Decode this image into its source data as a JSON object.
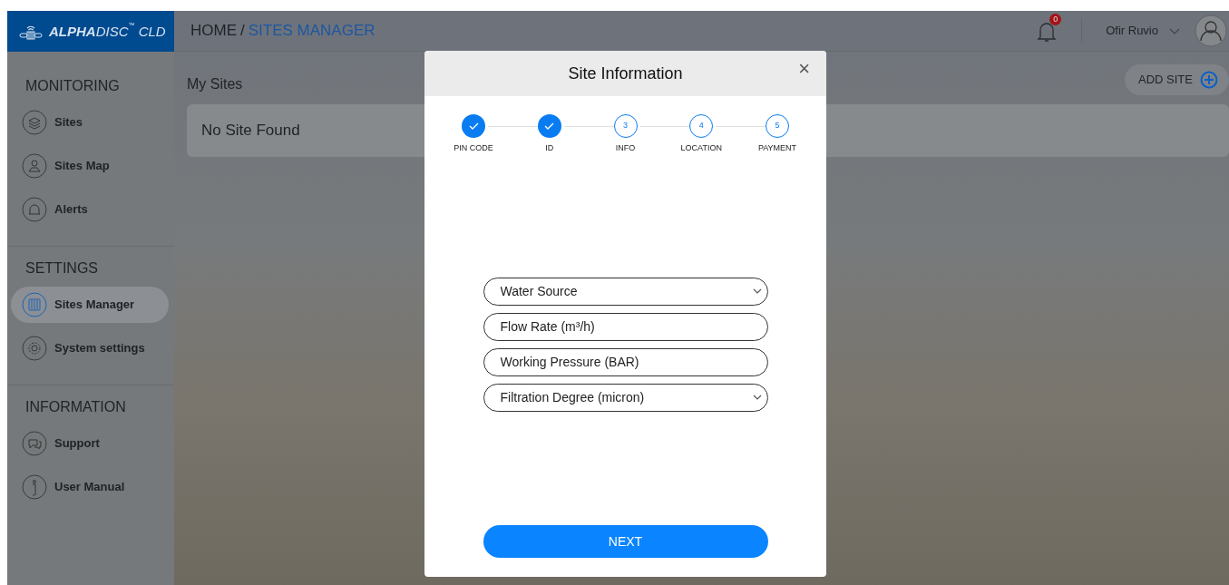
{
  "logo": {
    "brand_bold": "ALPHA",
    "brand_rest": "DISC",
    "trademark": "™",
    "suffix": "CLD"
  },
  "breadcrumb": {
    "items": [
      {
        "label": "HOME",
        "current": false
      },
      {
        "label": "SITES MANAGER",
        "current": true
      }
    ],
    "separator": "/"
  },
  "header": {
    "notification_count": "0",
    "user_name": "Ofir Ruvio"
  },
  "sidebar": {
    "sections": [
      {
        "title": "MONITORING",
        "items": [
          {
            "label": "Sites",
            "selected": false
          },
          {
            "label": "Sites Map",
            "selected": false
          },
          {
            "label": "Alerts",
            "selected": false
          }
        ]
      },
      {
        "title": "SETTINGS",
        "items": [
          {
            "label": "Sites Manager",
            "selected": true
          },
          {
            "label": "System settings",
            "selected": false
          }
        ]
      },
      {
        "title": "INFORMATION",
        "items": [
          {
            "label": "Support",
            "selected": false
          },
          {
            "label": "User Manual",
            "selected": false
          }
        ]
      }
    ]
  },
  "content": {
    "title": "My Sites",
    "add_button": "ADD SITE",
    "empty_message": "No Site Found"
  },
  "modal": {
    "title": "Site Information",
    "close": "×",
    "steps": [
      {
        "label": "PIN CODE",
        "done": true
      },
      {
        "label": "ID",
        "done": true
      },
      {
        "label": "INFO",
        "done": false,
        "number": "3"
      },
      {
        "label": "LOCATION",
        "done": false,
        "number": "4"
      },
      {
        "label": "PAYMENT",
        "done": false,
        "number": "5"
      }
    ],
    "fields": [
      {
        "kind": "select",
        "placeholder": "Water Source"
      },
      {
        "kind": "input",
        "placeholder": "Flow Rate (m³/h)"
      },
      {
        "kind": "input",
        "placeholder": "Working Pressure (BAR)"
      },
      {
        "kind": "select",
        "placeholder": "Filtration Degree (micron)"
      }
    ],
    "next_button": "NEXT"
  }
}
